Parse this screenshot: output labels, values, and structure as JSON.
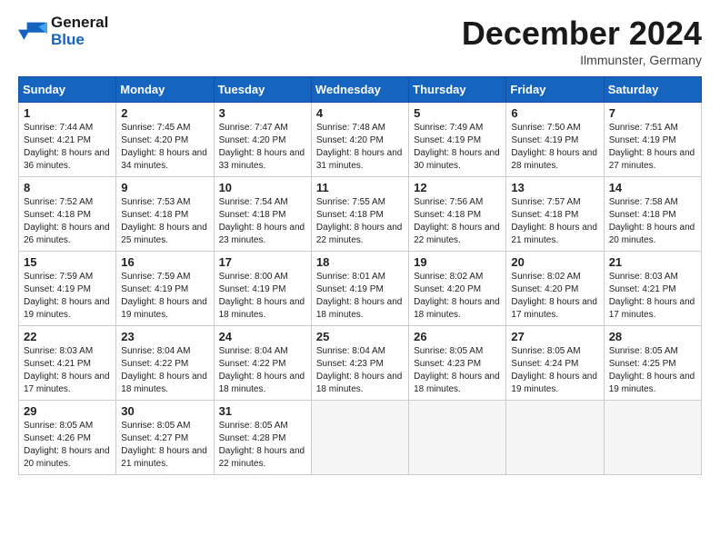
{
  "logo": {
    "line1": "General",
    "line2": "Blue"
  },
  "title": "December 2024",
  "location": "Ilmmunster, Germany",
  "days_of_week": [
    "Sunday",
    "Monday",
    "Tuesday",
    "Wednesday",
    "Thursday",
    "Friday",
    "Saturday"
  ],
  "weeks": [
    [
      {
        "day": "1",
        "sunrise": "Sunrise: 7:44 AM",
        "sunset": "Sunset: 4:21 PM",
        "daylight": "Daylight: 8 hours and 36 minutes."
      },
      {
        "day": "2",
        "sunrise": "Sunrise: 7:45 AM",
        "sunset": "Sunset: 4:20 PM",
        "daylight": "Daylight: 8 hours and 34 minutes."
      },
      {
        "day": "3",
        "sunrise": "Sunrise: 7:47 AM",
        "sunset": "Sunset: 4:20 PM",
        "daylight": "Daylight: 8 hours and 33 minutes."
      },
      {
        "day": "4",
        "sunrise": "Sunrise: 7:48 AM",
        "sunset": "Sunset: 4:20 PM",
        "daylight": "Daylight: 8 hours and 31 minutes."
      },
      {
        "day": "5",
        "sunrise": "Sunrise: 7:49 AM",
        "sunset": "Sunset: 4:19 PM",
        "daylight": "Daylight: 8 hours and 30 minutes."
      },
      {
        "day": "6",
        "sunrise": "Sunrise: 7:50 AM",
        "sunset": "Sunset: 4:19 PM",
        "daylight": "Daylight: 8 hours and 28 minutes."
      },
      {
        "day": "7",
        "sunrise": "Sunrise: 7:51 AM",
        "sunset": "Sunset: 4:19 PM",
        "daylight": "Daylight: 8 hours and 27 minutes."
      }
    ],
    [
      {
        "day": "8",
        "sunrise": "Sunrise: 7:52 AM",
        "sunset": "Sunset: 4:18 PM",
        "daylight": "Daylight: 8 hours and 26 minutes."
      },
      {
        "day": "9",
        "sunrise": "Sunrise: 7:53 AM",
        "sunset": "Sunset: 4:18 PM",
        "daylight": "Daylight: 8 hours and 25 minutes."
      },
      {
        "day": "10",
        "sunrise": "Sunrise: 7:54 AM",
        "sunset": "Sunset: 4:18 PM",
        "daylight": "Daylight: 8 hours and 23 minutes."
      },
      {
        "day": "11",
        "sunrise": "Sunrise: 7:55 AM",
        "sunset": "Sunset: 4:18 PM",
        "daylight": "Daylight: 8 hours and 22 minutes."
      },
      {
        "day": "12",
        "sunrise": "Sunrise: 7:56 AM",
        "sunset": "Sunset: 4:18 PM",
        "daylight": "Daylight: 8 hours and 22 minutes."
      },
      {
        "day": "13",
        "sunrise": "Sunrise: 7:57 AM",
        "sunset": "Sunset: 4:18 PM",
        "daylight": "Daylight: 8 hours and 21 minutes."
      },
      {
        "day": "14",
        "sunrise": "Sunrise: 7:58 AM",
        "sunset": "Sunset: 4:18 PM",
        "daylight": "Daylight: 8 hours and 20 minutes."
      }
    ],
    [
      {
        "day": "15",
        "sunrise": "Sunrise: 7:59 AM",
        "sunset": "Sunset: 4:19 PM",
        "daylight": "Daylight: 8 hours and 19 minutes."
      },
      {
        "day": "16",
        "sunrise": "Sunrise: 7:59 AM",
        "sunset": "Sunset: 4:19 PM",
        "daylight": "Daylight: 8 hours and 19 minutes."
      },
      {
        "day": "17",
        "sunrise": "Sunrise: 8:00 AM",
        "sunset": "Sunset: 4:19 PM",
        "daylight": "Daylight: 8 hours and 18 minutes."
      },
      {
        "day": "18",
        "sunrise": "Sunrise: 8:01 AM",
        "sunset": "Sunset: 4:19 PM",
        "daylight": "Daylight: 8 hours and 18 minutes."
      },
      {
        "day": "19",
        "sunrise": "Sunrise: 8:02 AM",
        "sunset": "Sunset: 4:20 PM",
        "daylight": "Daylight: 8 hours and 18 minutes."
      },
      {
        "day": "20",
        "sunrise": "Sunrise: 8:02 AM",
        "sunset": "Sunset: 4:20 PM",
        "daylight": "Daylight: 8 hours and 17 minutes."
      },
      {
        "day": "21",
        "sunrise": "Sunrise: 8:03 AM",
        "sunset": "Sunset: 4:21 PM",
        "daylight": "Daylight: 8 hours and 17 minutes."
      }
    ],
    [
      {
        "day": "22",
        "sunrise": "Sunrise: 8:03 AM",
        "sunset": "Sunset: 4:21 PM",
        "daylight": "Daylight: 8 hours and 17 minutes."
      },
      {
        "day": "23",
        "sunrise": "Sunrise: 8:04 AM",
        "sunset": "Sunset: 4:22 PM",
        "daylight": "Daylight: 8 hours and 18 minutes."
      },
      {
        "day": "24",
        "sunrise": "Sunrise: 8:04 AM",
        "sunset": "Sunset: 4:22 PM",
        "daylight": "Daylight: 8 hours and 18 minutes."
      },
      {
        "day": "25",
        "sunrise": "Sunrise: 8:04 AM",
        "sunset": "Sunset: 4:23 PM",
        "daylight": "Daylight: 8 hours and 18 minutes."
      },
      {
        "day": "26",
        "sunrise": "Sunrise: 8:05 AM",
        "sunset": "Sunset: 4:23 PM",
        "daylight": "Daylight: 8 hours and 18 minutes."
      },
      {
        "day": "27",
        "sunrise": "Sunrise: 8:05 AM",
        "sunset": "Sunset: 4:24 PM",
        "daylight": "Daylight: 8 hours and 19 minutes."
      },
      {
        "day": "28",
        "sunrise": "Sunrise: 8:05 AM",
        "sunset": "Sunset: 4:25 PM",
        "daylight": "Daylight: 8 hours and 19 minutes."
      }
    ],
    [
      {
        "day": "29",
        "sunrise": "Sunrise: 8:05 AM",
        "sunset": "Sunset: 4:26 PM",
        "daylight": "Daylight: 8 hours and 20 minutes."
      },
      {
        "day": "30",
        "sunrise": "Sunrise: 8:05 AM",
        "sunset": "Sunset: 4:27 PM",
        "daylight": "Daylight: 8 hours and 21 minutes."
      },
      {
        "day": "31",
        "sunrise": "Sunrise: 8:05 AM",
        "sunset": "Sunset: 4:28 PM",
        "daylight": "Daylight: 8 hours and 22 minutes."
      },
      null,
      null,
      null,
      null
    ]
  ]
}
